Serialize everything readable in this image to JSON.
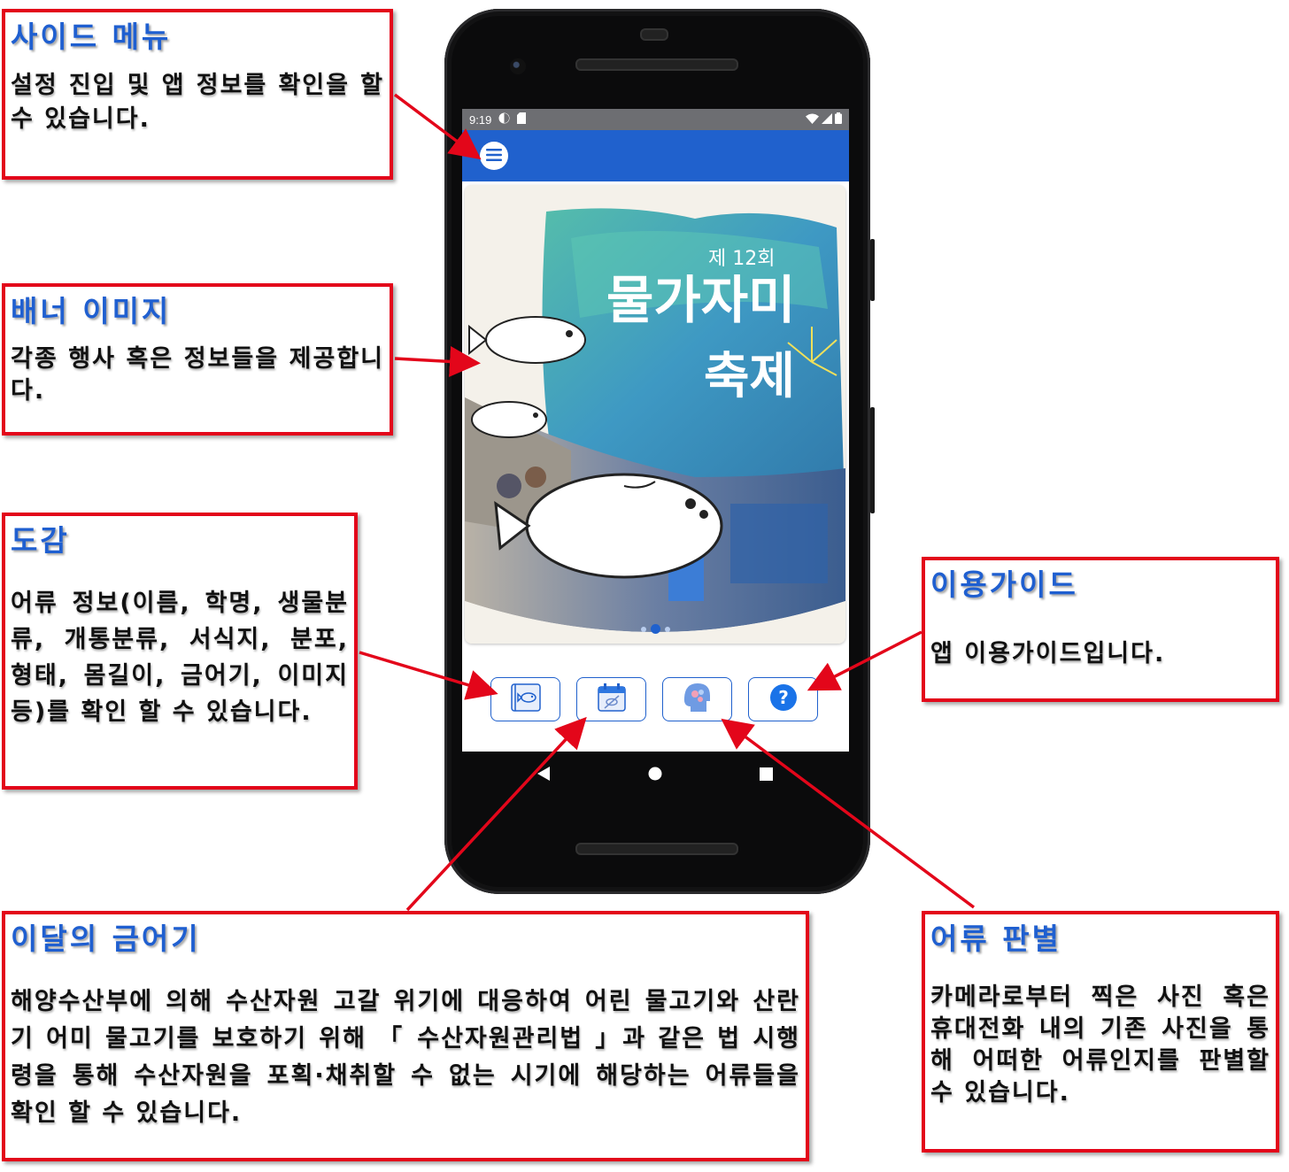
{
  "phone": {
    "status": {
      "time": "9:19"
    },
    "banner": {
      "edition": "제 12회",
      "title_line1": "물가자미",
      "title_line2": "축제",
      "carousel_total": 3,
      "carousel_active": 2
    }
  },
  "callouts": {
    "side_menu": {
      "title": "사이드 메뉴",
      "body": "설정 진입 및 앱 정보를 확인을 할 수 있습니다."
    },
    "banner_image": {
      "title": "배너 이미지",
      "body": "각종 행사 혹은 정보들을 제공합니다."
    },
    "encyclopedia": {
      "title": "도감",
      "body": "어류 정보(이름, 학명, 생물분류, 개통분류, 서식지, 분포, 형태, 몸길이, 금어기, 이미지 등)를 확인 할 수 있습니다."
    },
    "user_guide": {
      "title": "이용가이드",
      "body": "앱 이용가이드입니다."
    },
    "closed_season": {
      "title": "이달의 금어기",
      "body": "해양수산부에 의해 수산자원 고갈 위기에 대응하여 어린 물고기와 산란기 어미 물고기를 보호하기 위해 「 수산자원관리법 」과 같은 법 시행령을 통해 수산자원을 포획·채취할 수 없는 시기에 해당하는 어류들을 확인 할 수 있습니다."
    },
    "fish_id": {
      "title": "어류 판별",
      "body": "카메라로부터 찍은 사진 혹은 휴대전화 내의 기존 사진을 통해 어떠한 어류인지를 판별할 수 있습니다."
    }
  },
  "colors": {
    "accent": "#2061cd",
    "callout_border": "#e3061a",
    "callout_title": "#1f5fd0"
  },
  "icons": {
    "menu": "menu-icon",
    "encyclopedia": "fish-book-icon",
    "closed_season": "no-fishing-calendar-icon",
    "fish_id": "brain-head-icon",
    "guide": "help-icon"
  }
}
